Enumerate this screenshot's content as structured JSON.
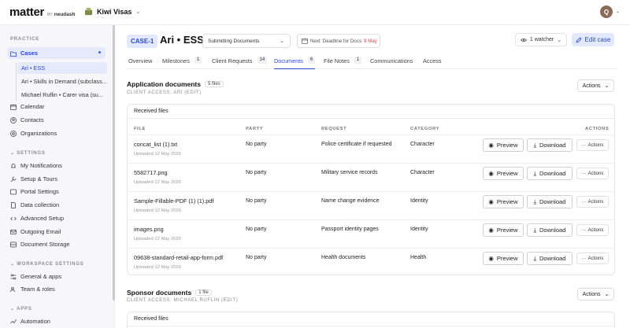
{
  "app": {
    "logo": "matter",
    "logo_by": "BY",
    "logo_brand": "neudash",
    "org_name": "Kiwi Visas",
    "avatar_initial": "Q"
  },
  "sidebar": {
    "practice_label": "PRACTICE",
    "cases_label": "Cases",
    "case_items": [
      "Ari • ESS",
      "Ari • Skills in Demand (subclass...",
      "Michael Ruflin • Carer visa (su..."
    ],
    "items": [
      "Calendar",
      "Contacts",
      "Organizations"
    ],
    "settings_label": "SETTINGS",
    "settings_items": [
      "My Notifications",
      "Setup & Tours",
      "Portal Settings",
      "Data collection",
      "Advanced Setup",
      "Outgoing Email",
      "Document Storage"
    ],
    "workspace_label": "WORKSPACE SETTINGS",
    "workspace_items": [
      "General & apps",
      "Team & roles"
    ],
    "apps_label": "APPS",
    "apps_items": [
      "Automation"
    ]
  },
  "header": {
    "case_id": "CASE-1",
    "title": "Ari • ESS",
    "status": "Submitting Documents",
    "deadline_label": "Next",
    "deadline_text": "Deadline for Docs",
    "deadline_date": "9 May",
    "watcher": "1 watcher",
    "edit_label": "Edit case"
  },
  "tabs": [
    {
      "label": "Overview",
      "count": null
    },
    {
      "label": "Milestones",
      "count": "1"
    },
    {
      "label": "Client Requests",
      "count": "14"
    },
    {
      "label": "Documents",
      "count": "6"
    },
    {
      "label": "File Notes",
      "count": "1"
    },
    {
      "label": "Communications",
      "count": null
    },
    {
      "label": "Access",
      "count": null
    }
  ],
  "application": {
    "title": "Application documents",
    "count": "5 files",
    "subtitle": "CLIENT ACCESS: ARI (EDIT)",
    "actions": "Actions",
    "card_title": "Received files",
    "columns": [
      "FILE",
      "PARTY",
      "REQUEST",
      "CATEGORY",
      "ACTIONS"
    ],
    "rows": [
      {
        "file": "concat_list (1).txt",
        "date": "Uploaded 12 May 2026",
        "party": "No party",
        "request": "Police certificate if requested",
        "category": "Character"
      },
      {
        "file": "5582717.png",
        "date": "Uploaded 12 May 2026",
        "party": "No party",
        "request": "Military service records",
        "category": "Character"
      },
      {
        "file": "Sample-Fillable-PDF (1) (1).pdf",
        "date": "Uploaded 12 May 2026",
        "party": "No party",
        "request": "Name change evidence",
        "category": "Identity"
      },
      {
        "file": "images.png",
        "date": "Uploaded 12 May 2026",
        "party": "No party",
        "request": "Passport identity pages",
        "category": "Identity"
      },
      {
        "file": "09638-standard-retail-app-form.pdf",
        "date": "Uploaded 12 May 2026",
        "party": "No party",
        "request": "Health documents",
        "category": "Health"
      }
    ],
    "preview_label": "Preview",
    "download_label": "Download",
    "row_actions_label": "Actions"
  },
  "sponsor": {
    "title": "Sponsor documents",
    "count": "1 file",
    "subtitle": "CLIENT ACCESS: MICHAEL RUFLIN (EDIT)",
    "actions": "Actions",
    "card_title": "Received files"
  }
}
